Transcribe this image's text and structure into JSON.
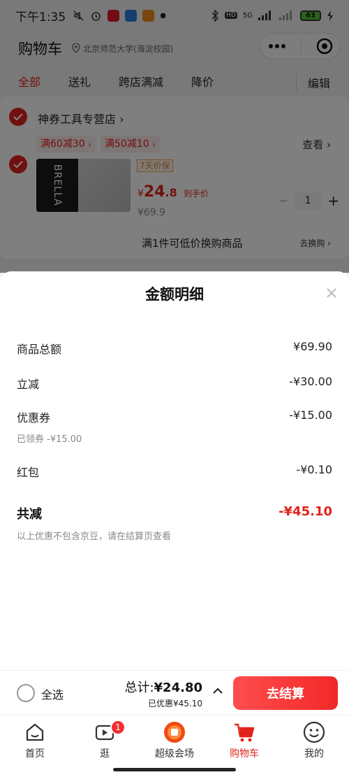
{
  "status_bar": {
    "time": "下午1:35",
    "network": "5G",
    "hd": "HD",
    "battery": "63"
  },
  "header": {
    "title": "购物车",
    "location": "北京师范大学(海淀校园)"
  },
  "tabs": [
    "全部",
    "送礼",
    "跨店满减",
    "降价"
  ],
  "edit_label": "编辑",
  "store": {
    "name": "神券工具专营店",
    "promos": [
      "满60减30",
      "满50减10"
    ],
    "view_label": "查看",
    "product": {
      "brand_text": "BRELLA",
      "price_protect": "7天价保",
      "price_symbol": "¥",
      "price_int": "24",
      "price_dec": ".8",
      "price_note": "到手价",
      "original_price": "¥69.9",
      "quantity": "1",
      "minus": "−",
      "plus": "+"
    },
    "swap_text": "满1件可低价换购商品",
    "swap_link": "去换购"
  },
  "sheet": {
    "title": "金额明细",
    "rows": [
      {
        "label": "商品总额",
        "value": "¥69.90"
      },
      {
        "label": "立减",
        "value": "-¥30.00"
      },
      {
        "label": "优惠券",
        "value": "-¥15.00",
        "sub": "已领券 -¥15.00"
      },
      {
        "label": "红包",
        "value": "-¥0.10"
      }
    ],
    "total_label": "共减",
    "total_value": "-¥45.10",
    "note": "以上优惠不包含京豆，请在结算页查看"
  },
  "checkout": {
    "select_all": "全选",
    "total_prefix": "总计:",
    "total_amount": "¥24.80",
    "saved": "已优惠¥45.10",
    "pay_button": "去结算"
  },
  "nav": [
    {
      "label": "首页",
      "icon": "home-icon"
    },
    {
      "label": "逛",
      "icon": "video-icon",
      "badge": "1"
    },
    {
      "label": "超级会场",
      "icon": "super-venue-icon"
    },
    {
      "label": "购物车",
      "icon": "cart-icon",
      "active": true
    },
    {
      "label": "我的",
      "icon": "profile-icon"
    }
  ],
  "colors": {
    "accent": "#e2231a",
    "button_gradient_start": "#ff4d4d",
    "button_gradient_end": "#f22828"
  }
}
